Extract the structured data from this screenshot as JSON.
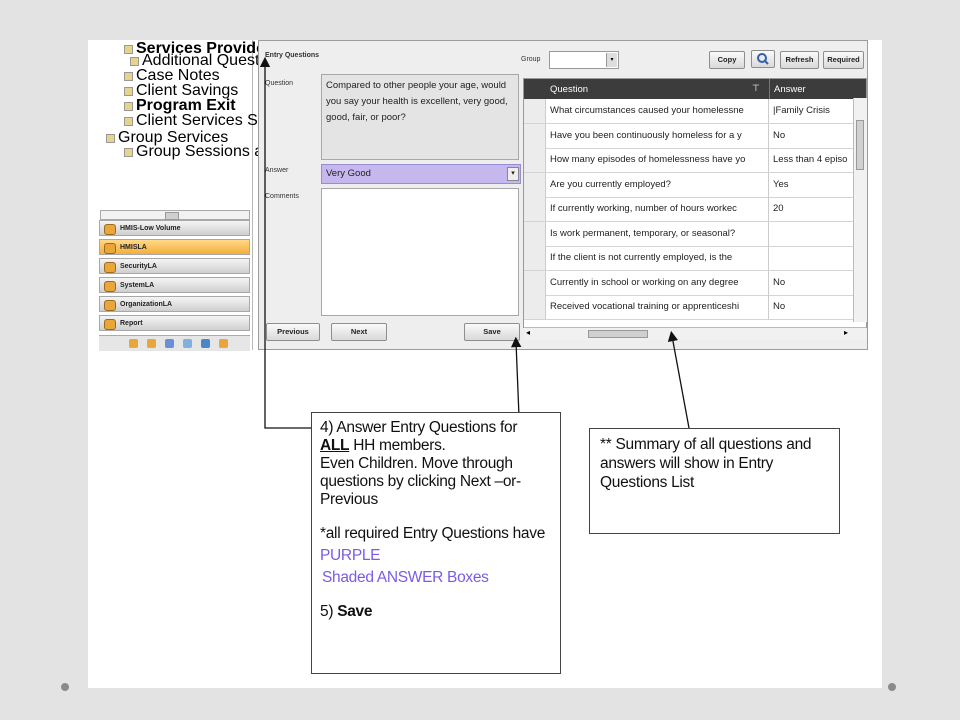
{
  "nav": {
    "tree": [
      {
        "label": "Services Provided",
        "bold": true
      },
      {
        "label": "Additional Questions",
        "bold": false
      },
      {
        "label": "Case Notes",
        "bold": false
      },
      {
        "label": "Client Savings",
        "bold": false
      },
      {
        "label": "Program Exit",
        "bold": true
      },
      {
        "label": "Client Services Search",
        "bold": false
      },
      {
        "label": "Group Services",
        "bold": false
      },
      {
        "label": "Group Sessions and Auto-Schedu",
        "bold": false
      }
    ],
    "modules": [
      {
        "label": "HMIS-Low Volume",
        "active": false
      },
      {
        "label": "HMISLA",
        "active": true
      },
      {
        "label": "SecurityLA",
        "active": false
      },
      {
        "label": "SystemLA",
        "active": false
      },
      {
        "label": "OrganizationLA",
        "active": false
      },
      {
        "label": "Report",
        "active": false
      }
    ]
  },
  "entry": {
    "title": "Entry Questions",
    "question_label": "Question",
    "question_text": "Compared to other people your age, would you say your health is excellent, very good, good, fair, or poor?",
    "answer_label": "Answer",
    "answer_value": "Very Good",
    "comments_label": "Comments",
    "prev_button": "Previous",
    "next_button": "Next",
    "save_button": "Save"
  },
  "toolbar": {
    "group_label": "Group",
    "copy_button": "Copy",
    "refresh_button": "Refresh",
    "required_button": "Required"
  },
  "grid": {
    "columns": [
      "Question",
      "Answer"
    ],
    "rows": [
      {
        "q": "What circumstances caused your homelessne",
        "a": "|Family Crisis"
      },
      {
        "q": "Have you been continuously homeless for a y",
        "a": "No"
      },
      {
        "q": "How many episodes of homelessness have yo",
        "a": "Less than 4 episo"
      },
      {
        "q": "Are you currently employed?",
        "a": "Yes"
      },
      {
        "q": "If currently working, number of hours workec",
        "a": "20"
      },
      {
        "q": "Is work permanent, temporary, or seasonal?",
        "a": ""
      },
      {
        "q": "If the client is not currently employed, is the",
        "a": ""
      },
      {
        "q": "Currently in school or working on any degree",
        "a": "No"
      },
      {
        "q": "Received vocational training or apprenticeshi",
        "a": "No"
      }
    ]
  },
  "callout1": {
    "line1": "4) Answer Entry Questions for",
    "line2_bold": "ALL",
    "line2_rest": " HH members.",
    "line3": "Even Children. Move through questions by clicking Next –or- Previous",
    "line4": "*all required Entry Questions have ",
    "line4_purple": "PURPLE",
    "line5_purple": "Shaded  ANSWER Boxes",
    "line6_prefix": "5) ",
    "line6_bold": "Save"
  },
  "callout2": {
    "text": "** Summary of all questions and answers will show in Entry Questions List"
  },
  "colors": {
    "answer_purple": "#c6b7ee",
    "callout_purple": "#7b5be6",
    "active_module": "#f5ae3a"
  }
}
